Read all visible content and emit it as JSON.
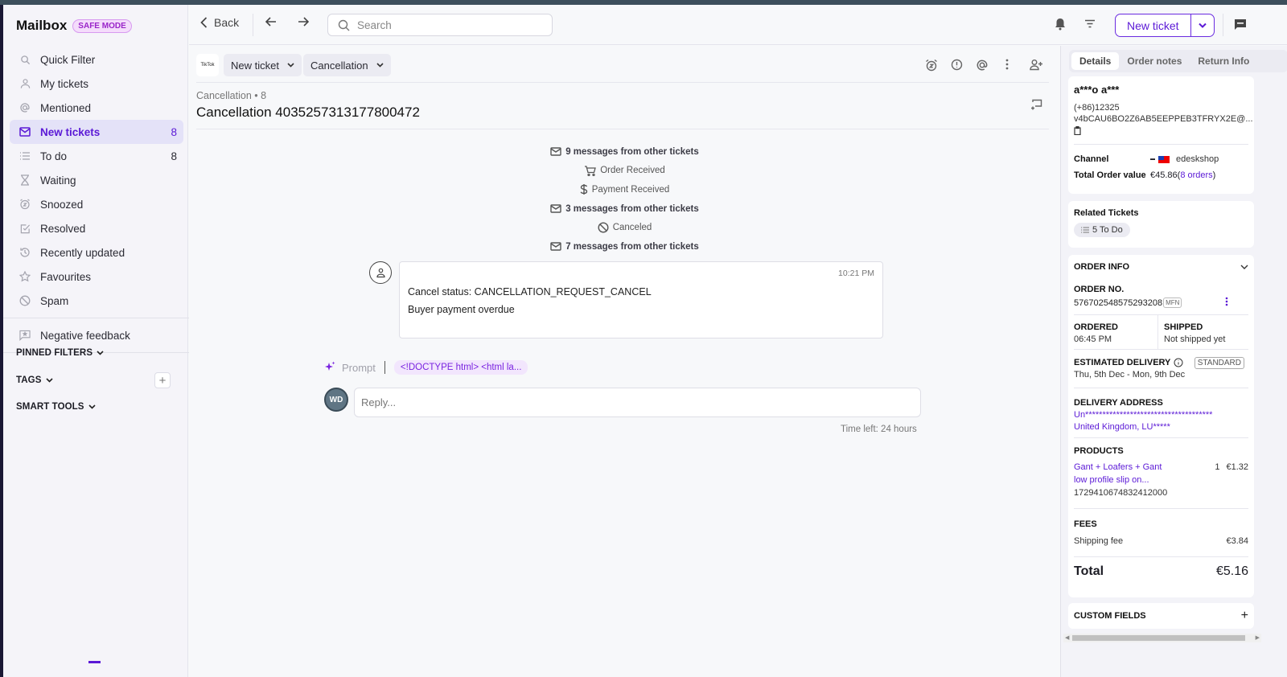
{
  "app": {
    "title": "Mailbox",
    "mode_badge": "SAFE MODE"
  },
  "sidebar": {
    "items": [
      {
        "label": "Quick Filter",
        "icon": "search-icon",
        "count": ""
      },
      {
        "label": "My tickets",
        "icon": "user-icon",
        "count": ""
      },
      {
        "label": "Mentioned",
        "icon": "at-icon",
        "count": ""
      },
      {
        "label": "New tickets",
        "icon": "mail-icon",
        "count": "8",
        "active": true
      },
      {
        "label": "To do",
        "icon": "list-icon",
        "count": "8"
      },
      {
        "label": "Waiting",
        "icon": "hourglass-icon",
        "count": ""
      },
      {
        "label": "Snoozed",
        "icon": "alarm-icon",
        "count": ""
      },
      {
        "label": "Resolved",
        "icon": "check-square-icon",
        "count": ""
      },
      {
        "label": "Recently updated",
        "icon": "history-icon",
        "count": ""
      },
      {
        "label": "Favourites",
        "icon": "star-icon",
        "count": ""
      },
      {
        "label": "Spam",
        "icon": "ban-icon",
        "count": ""
      }
    ],
    "extra_item": {
      "label": "Negative feedback",
      "icon": "feedback-icon"
    },
    "sections": {
      "pinned": "PINNED FILTERS",
      "tags": "TAGS",
      "smart_tools": "SMART TOOLS"
    }
  },
  "topbar": {
    "back_label": "Back",
    "search_placeholder": "Search",
    "new_ticket_label": "New ticket"
  },
  "ticket": {
    "channel_logo_text": "TikTok",
    "status_pill": "New ticket",
    "type_pill": "Cancellation",
    "breadcrumb": "Cancellation • 8",
    "title": "Cancellation 4035257313177800472",
    "events": [
      {
        "text": "9 messages from other tickets",
        "icon": "mail-icon",
        "bold": true
      },
      {
        "text": "Order Received",
        "icon": "cart-icon",
        "bold": false
      },
      {
        "text": "Payment Received",
        "icon": "dollar-icon",
        "bold": false
      },
      {
        "text": "3 messages from other tickets",
        "icon": "mail-icon",
        "bold": true
      },
      {
        "text": "Canceled",
        "icon": "ban-icon",
        "bold": false
      },
      {
        "text": "7 messages from other tickets",
        "icon": "mail-icon",
        "bold": true
      }
    ],
    "message": {
      "time": "10:21 PM",
      "line1": "Cancel status: CANCELLATION_REQUEST_CANCEL",
      "line2": "Buyer payment overdue"
    },
    "prompt_label": "Prompt",
    "prompt_chip": "<!DOCTYPE html> <html la...",
    "agent_initials": "WD",
    "reply_placeholder": "Reply...",
    "time_left": "Time left: 24 hours"
  },
  "details": {
    "tabs": [
      "Details",
      "Order notes",
      "Return Info"
    ],
    "customer": {
      "name": "a***o a***",
      "phone": "(+86)12325",
      "email": "v4bCAU6BO2Z6AB5EEPPEB3TFRYX2E@...",
      "channel_label": "Channel",
      "channel_value": "edeskshop",
      "total_label": "Total Order value",
      "total_value": "€45.86(",
      "orders_link": "8 orders",
      "total_suffix": ")"
    },
    "related": {
      "title": "Related Tickets",
      "chip": "5 To Do"
    },
    "order": {
      "title": "ORDER INFO",
      "order_no_label": "ORDER NO.",
      "order_no": "576702548575293208",
      "order_badge": "MFN",
      "ordered_label": "ORDERED",
      "ordered_value": "06:45 PM",
      "shipped_label": "SHIPPED",
      "shipped_value": "Not shipped yet",
      "est_label": "ESTIMATED DELIVERY",
      "est_badge": "STANDARD",
      "est_value": "Thu, 5th Dec - Mon, 9th Dec",
      "addr_label": "DELIVERY ADDRESS",
      "addr_line1": "Un*************************************",
      "addr_line2": "United Kingdom, LU*****",
      "products_label": "PRODUCTS",
      "product_name1": "Gant + Loafers + Gant",
      "product_name2": "low profile slip on...",
      "product_sku": "1729410674832412000",
      "product_qty": "1",
      "product_price": "€1.32",
      "fees_label": "FEES",
      "fee_name": "Shipping fee",
      "fee_value": "€3.84",
      "total_label": "Total",
      "total_value": "€5.16"
    },
    "custom_fields": "CUSTOM FIELDS"
  },
  "colors": {
    "accent": "#5b19d6",
    "safe_badge": "#9a24c9"
  }
}
